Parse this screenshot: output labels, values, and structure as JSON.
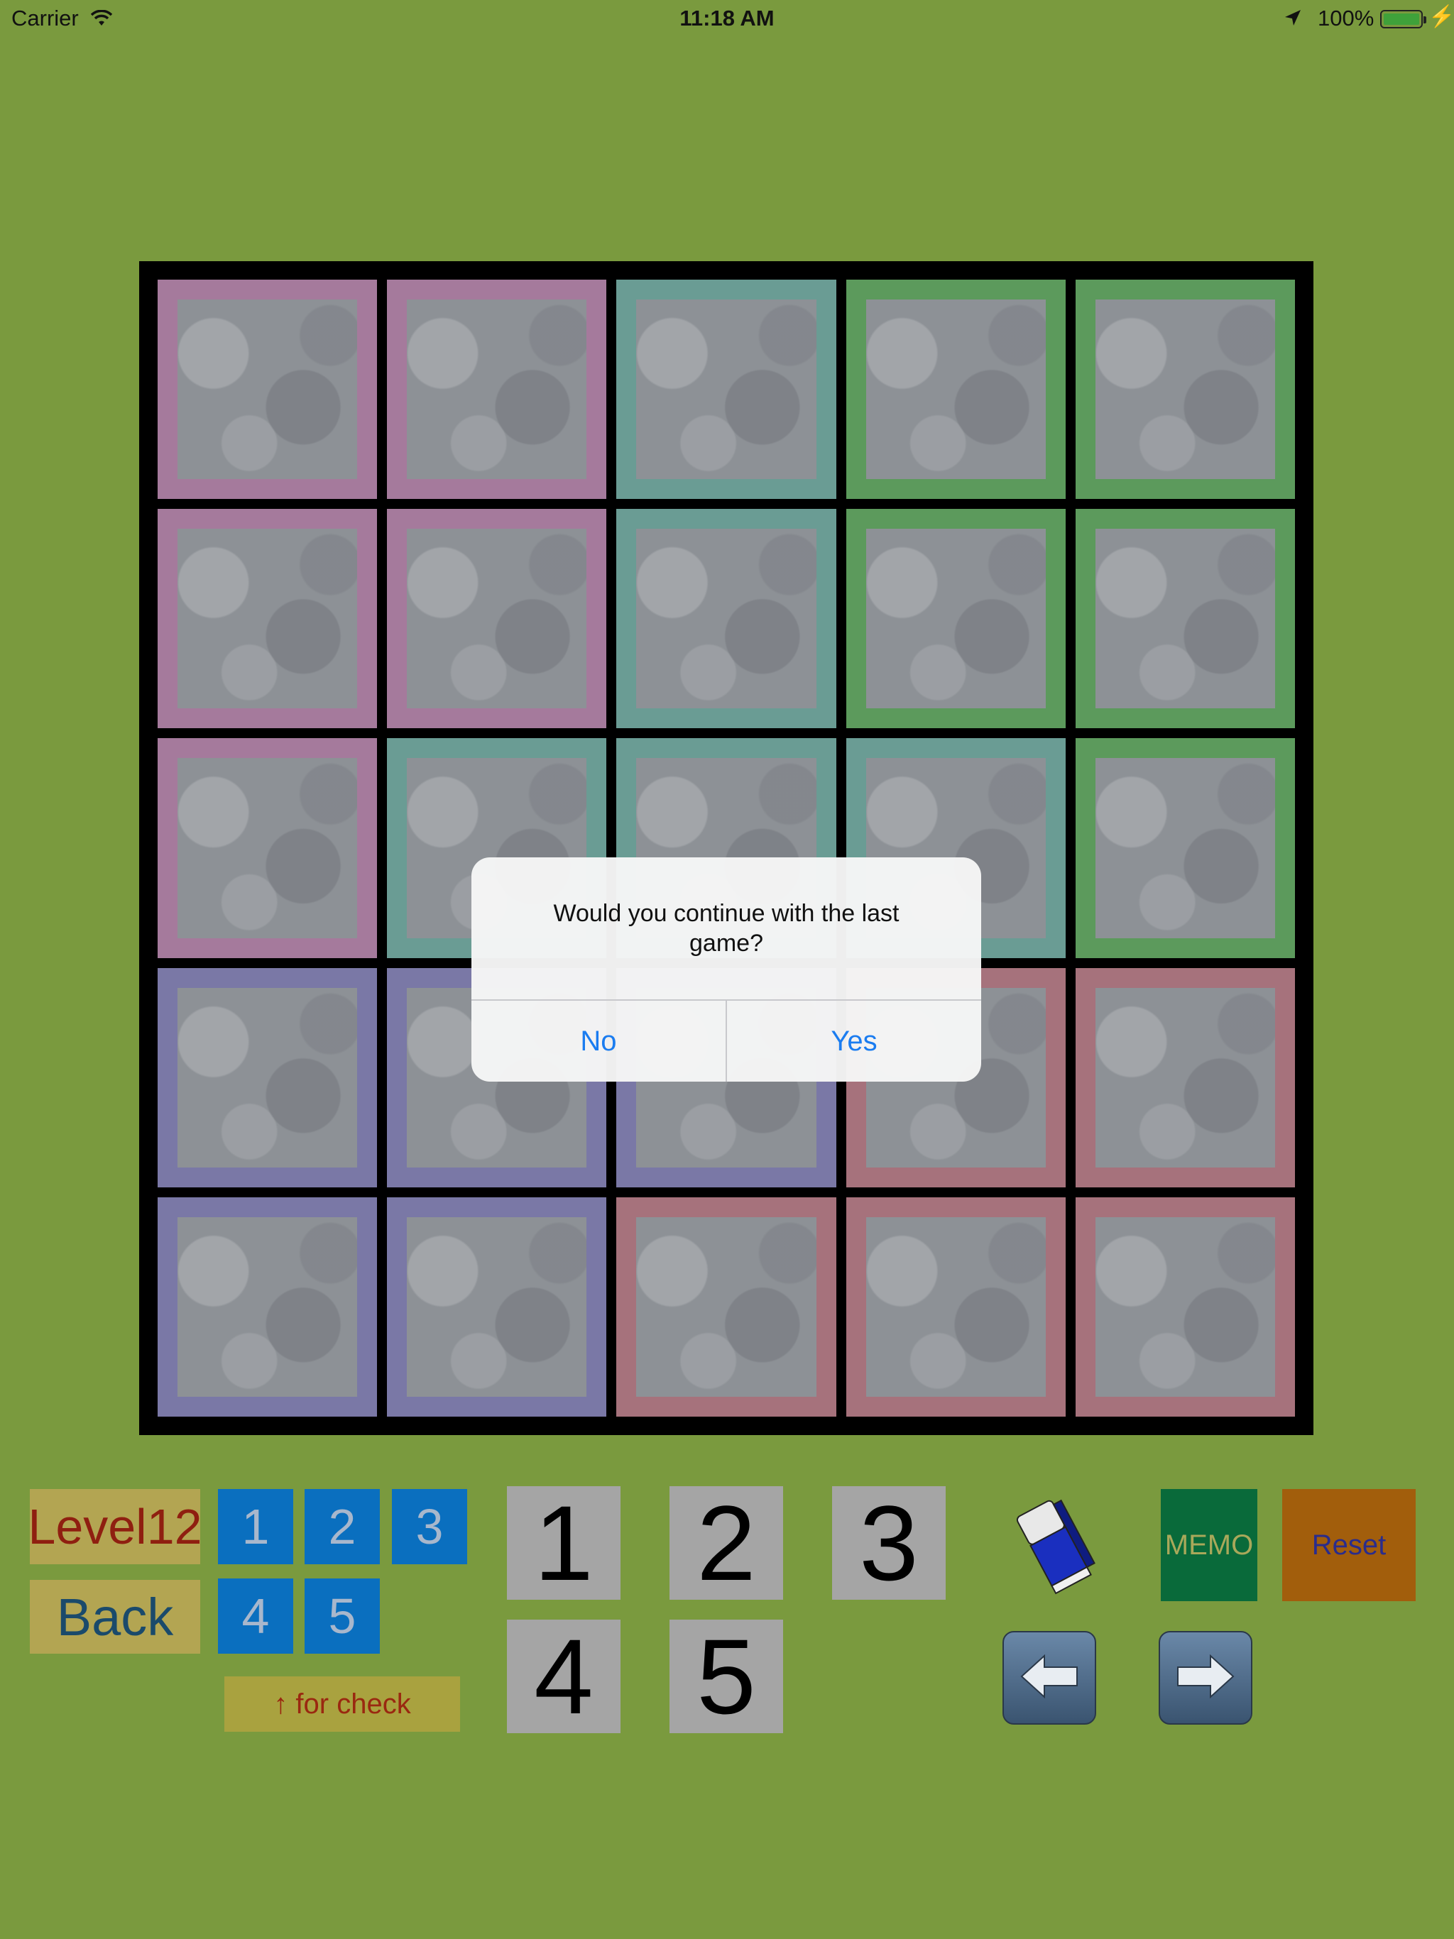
{
  "status_bar": {
    "carrier": "Carrier",
    "time": "11:18 AM",
    "battery": "100%"
  },
  "board": {
    "size": 5,
    "region_colors": {
      "pink": "#a57a9c",
      "teal": "#6a9c94",
      "green": "#5c9a5c",
      "violet": "#7a78a6",
      "rose": "#a6727c"
    },
    "regions": [
      [
        "pink",
        "pink",
        "teal",
        "green",
        "green"
      ],
      [
        "pink",
        "pink",
        "teal",
        "green",
        "green"
      ],
      [
        "pink",
        "teal",
        "teal",
        "teal",
        "green"
      ],
      [
        "violet",
        "violet",
        "violet",
        "rose",
        "rose"
      ],
      [
        "violet",
        "violet",
        "rose",
        "rose",
        "rose"
      ]
    ]
  },
  "dialog": {
    "message": "Would you continue with the last game?",
    "no_label": "No",
    "yes_label": "Yes"
  },
  "controls": {
    "level_label": "Level12",
    "back_label": "Back",
    "check_label": "↑ for check",
    "size_options": [
      "1",
      "2",
      "3",
      "4",
      "5"
    ],
    "number_keys": [
      "1",
      "2",
      "3",
      "4",
      "5"
    ],
    "memo_label": "MEMO",
    "reset_label": "Reset"
  },
  "colors": {
    "background": "#7a9a3e",
    "size_button": "#0a6fbf",
    "memo": "#096a3a",
    "reset": "#a25e0c",
    "dialog_button": "#1a7cf0"
  },
  "icons": {
    "eraser": "eraser-icon",
    "undo": "arrow-left-icon",
    "redo": "arrow-right-icon"
  }
}
